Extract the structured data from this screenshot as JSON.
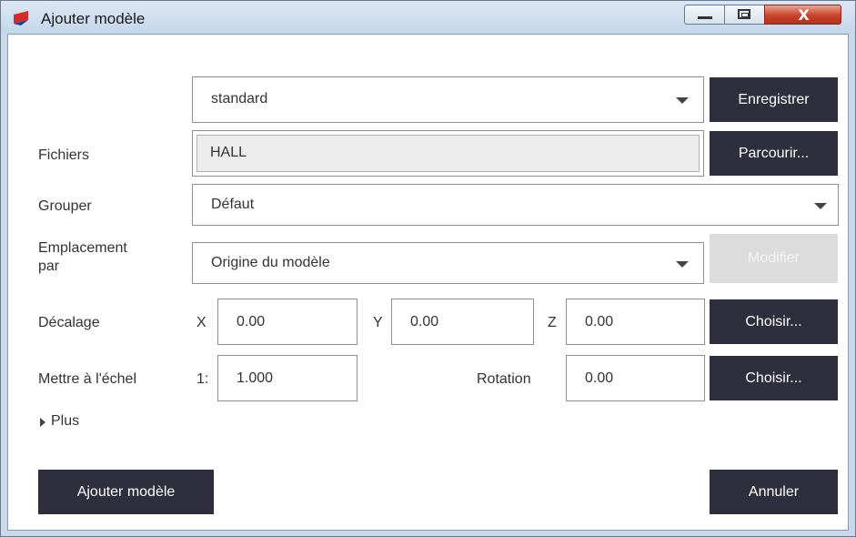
{
  "window": {
    "title": "Ajouter modèle",
    "close_glyph": "X"
  },
  "colors": {
    "button_bg": "#2e2e3c",
    "button_disabled_bg": "#dcdcdc",
    "title_bg": "#c5d6ea"
  },
  "template": {
    "value": "standard",
    "save_label": "Enregistrer"
  },
  "files": {
    "label": "Fichiers",
    "value": "HALL",
    "browse_label": "Parcourir..."
  },
  "group": {
    "label": "Grouper",
    "value": "Défaut"
  },
  "placement": {
    "label_line1": "Emplacement",
    "label_line2": "par",
    "value": "Origine du modèle",
    "modify_label": "Modifier"
  },
  "offset": {
    "label": "Décalage",
    "x_label": "X",
    "x_value": "0.00",
    "y_label": "Y",
    "y_value": "0.00",
    "z_label": "Z",
    "z_value": "0.00",
    "choose_label": "Choisir..."
  },
  "scale": {
    "label": "Mettre à l'échel",
    "prefix": "1:",
    "value": "1.000",
    "rotation_label": "Rotation",
    "rotation_value": "0.00",
    "choose_label": "Choisir..."
  },
  "more": {
    "label": "Plus",
    "icon": "triangle-right-icon"
  },
  "footer": {
    "add_label": "Ajouter modèle",
    "cancel_label": "Annuler"
  }
}
